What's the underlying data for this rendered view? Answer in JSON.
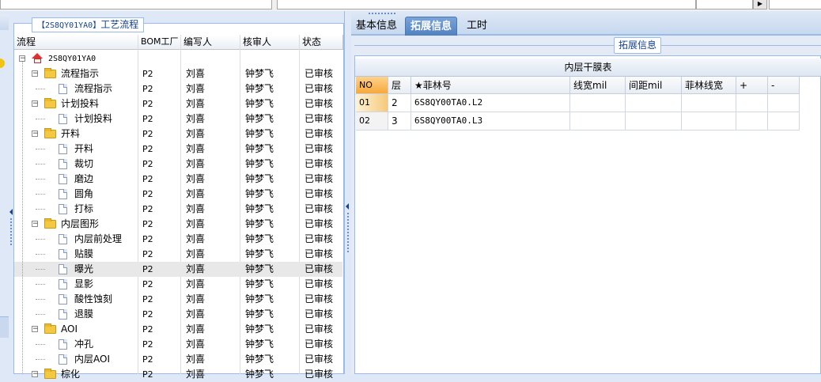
{
  "flow_panel": {
    "title_code": "【2S8QY01YA0】",
    "title_text": "工艺流程",
    "columns": [
      "流程",
      "BOM工厂",
      "编写人",
      "核审人",
      "状态"
    ],
    "root": "2S8QY01YA0",
    "rows": [
      {
        "name": "流程指示",
        "level": 1,
        "type": "folder",
        "bom": "P2",
        "writer": "刘喜",
        "reviewer": "钟梦飞",
        "status": "已审核"
      },
      {
        "name": "流程指示",
        "level": 2,
        "type": "doc",
        "bom": "P2",
        "writer": "刘喜",
        "reviewer": "钟梦飞",
        "status": "已审核"
      },
      {
        "name": "计划投料",
        "level": 1,
        "type": "folder",
        "bom": "P2",
        "writer": "刘喜",
        "reviewer": "钟梦飞",
        "status": "已审核"
      },
      {
        "name": "计划投料",
        "level": 2,
        "type": "doc",
        "bom": "P2",
        "writer": "刘喜",
        "reviewer": "钟梦飞",
        "status": "已审核"
      },
      {
        "name": "开料",
        "level": 1,
        "type": "folder",
        "bom": "P2",
        "writer": "刘喜",
        "reviewer": "钟梦飞",
        "status": "已审核"
      },
      {
        "name": "开料",
        "level": 2,
        "type": "doc",
        "bom": "P2",
        "writer": "刘喜",
        "reviewer": "钟梦飞",
        "status": "已审核"
      },
      {
        "name": "裁切",
        "level": 2,
        "type": "doc",
        "bom": "P2",
        "writer": "刘喜",
        "reviewer": "钟梦飞",
        "status": "已审核"
      },
      {
        "name": "磨边",
        "level": 2,
        "type": "doc",
        "bom": "P2",
        "writer": "刘喜",
        "reviewer": "钟梦飞",
        "status": "已审核"
      },
      {
        "name": "圆角",
        "level": 2,
        "type": "doc",
        "bom": "P2",
        "writer": "刘喜",
        "reviewer": "钟梦飞",
        "status": "已审核"
      },
      {
        "name": "打标",
        "level": 2,
        "type": "doc",
        "bom": "P2",
        "writer": "刘喜",
        "reviewer": "钟梦飞",
        "status": "已审核"
      },
      {
        "name": "内层图形",
        "level": 1,
        "type": "folder",
        "bom": "P2",
        "writer": "刘喜",
        "reviewer": "钟梦飞",
        "status": "已审核"
      },
      {
        "name": "内层前处理",
        "level": 2,
        "type": "doc",
        "bom": "P2",
        "writer": "刘喜",
        "reviewer": "钟梦飞",
        "status": "已审核"
      },
      {
        "name": "贴膜",
        "level": 2,
        "type": "doc",
        "bom": "P2",
        "writer": "刘喜",
        "reviewer": "钟梦飞",
        "status": "已审核"
      },
      {
        "name": "曝光",
        "level": 2,
        "type": "doc",
        "bom": "P2",
        "writer": "刘喜",
        "reviewer": "钟梦飞",
        "status": "已审核",
        "selected": true
      },
      {
        "name": "显影",
        "level": 2,
        "type": "doc",
        "bom": "P2",
        "writer": "刘喜",
        "reviewer": "钟梦飞",
        "status": "已审核"
      },
      {
        "name": "酸性蚀刻",
        "level": 2,
        "type": "doc",
        "bom": "P2",
        "writer": "刘喜",
        "reviewer": "钟梦飞",
        "status": "已审核"
      },
      {
        "name": "退膜",
        "level": 2,
        "type": "doc",
        "bom": "P2",
        "writer": "刘喜",
        "reviewer": "钟梦飞",
        "status": "已审核"
      },
      {
        "name": "AOI",
        "level": 1,
        "type": "folder",
        "bom": "P2",
        "writer": "刘喜",
        "reviewer": "钟梦飞",
        "status": "已审核"
      },
      {
        "name": "冲孔",
        "level": 2,
        "type": "doc",
        "bom": "P2",
        "writer": "刘喜",
        "reviewer": "钟梦飞",
        "status": "已审核"
      },
      {
        "name": "内层AOI",
        "level": 2,
        "type": "doc",
        "bom": "P2",
        "writer": "刘喜",
        "reviewer": "钟梦飞",
        "status": "已审核"
      },
      {
        "name": "棕化",
        "level": 1,
        "type": "folder",
        "bom": "P2",
        "writer": "刘喜",
        "reviewer": "钟梦飞",
        "status": "已审核"
      }
    ]
  },
  "tabs": [
    {
      "label": "基本信息",
      "active": false
    },
    {
      "label": "拓展信息",
      "active": true
    },
    {
      "label": "工时",
      "active": false
    }
  ],
  "detail": {
    "legend": "拓展信息",
    "table_title": "内层干膜表",
    "columns": [
      "NO",
      "层",
      "★菲林号",
      "线宽mil",
      "间距mil",
      "菲林线宽",
      "+",
      "-"
    ],
    "rows": [
      {
        "no": "01",
        "layer": "2",
        "film": "6S8QY00TA0.L2",
        "width": "",
        "spacing": "",
        "film_width": "",
        "plus": "",
        "minus": ""
      },
      {
        "no": "02",
        "layer": "3",
        "film": "6S8QY00TA0.L3",
        "width": "",
        "spacing": "",
        "film_width": "",
        "plus": "",
        "minus": ""
      }
    ]
  }
}
